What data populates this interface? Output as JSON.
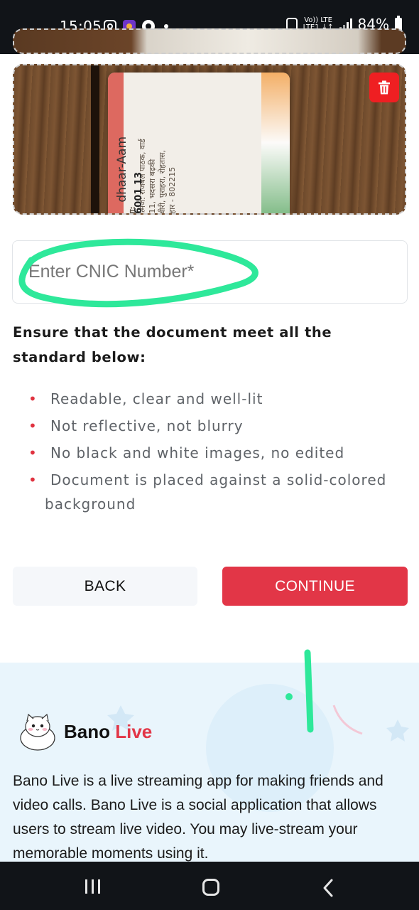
{
  "status_bar": {
    "time": "15:05",
    "network_top": "Vo)) LTE",
    "network_bottom": "LTE1 ↓↑",
    "battery": "84%"
  },
  "document": {
    "delete_icon": "trash-icon",
    "card": {
      "address_label": "पता:",
      "address_lines": [
        "आत्मज: राजबल पाठक, वार्ड",
        "नं 11, भदसरा बढ़की",
        "कबीरी, पुराहरा, रोहतास,",
        "बिहार - 802215"
      ],
      "number_partial": "6001 13",
      "brand_partial": "dhaar-Aam"
    }
  },
  "cnic_input": {
    "placeholder": "Enter CNIC Number*",
    "value": ""
  },
  "requirements": {
    "heading": "Ensure that the document meet all the standard below:",
    "items": [
      "Readable, clear and well-lit",
      "Not reflective, not blurry",
      "No black and white images, no edited",
      "Document is placed against a solid-colored"
    ],
    "item_4_continuation": "background"
  },
  "buttons": {
    "back": "BACK",
    "continue": "CONTINUE"
  },
  "promo": {
    "title_main": "Bano ",
    "title_accent": "Live",
    "description": "Bano Live is a live streaming app for making friends and video calls. Bano Live is a social application that allows users to stream live video. You may live-stream your memorable moments using it.",
    "logo_icon": "cat-mascot-icon"
  },
  "colors": {
    "primary": "#e23647",
    "delete": "#ef1f22",
    "highlight_marker": "#2ee89a",
    "status_bar_bg": "#111418",
    "promo_bg": "#e9f5fc"
  },
  "nav_icons": [
    "recent-apps-icon",
    "home-icon",
    "back-icon"
  ]
}
